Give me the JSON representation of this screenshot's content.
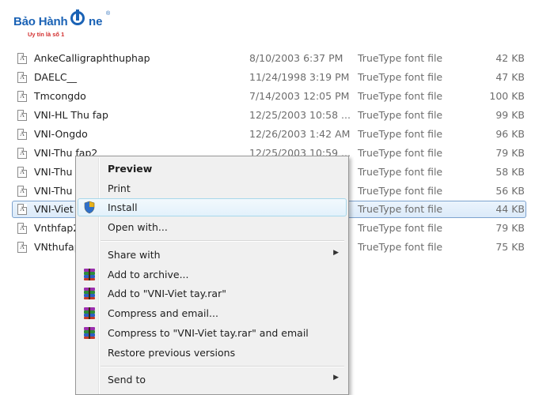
{
  "logo": {
    "brand": "Bảo Hành",
    "suffix": "ne",
    "reg": "®",
    "tagline": "Uy tín là số 1"
  },
  "files": [
    {
      "name": "AnkeCalligraphthuphap",
      "date": "8/10/2003 6:37 PM",
      "type": "TrueType font file",
      "size": "42 KB",
      "selected": false
    },
    {
      "name": "DAELC__",
      "date": "11/24/1998 3:19 PM",
      "type": "TrueType font file",
      "size": "47 KB",
      "selected": false
    },
    {
      "name": "Tmcongdo",
      "date": "7/14/2003 12:05 PM",
      "type": "TrueType font file",
      "size": "100 KB",
      "selected": false
    },
    {
      "name": "VNI-HL Thu fap",
      "date": "12/25/2003 10:58 ...",
      "type": "TrueType font file",
      "size": "99 KB",
      "selected": false
    },
    {
      "name": "VNI-Ongdo",
      "date": "12/26/2003 1:42 AM",
      "type": "TrueType font file",
      "size": "96 KB",
      "selected": false
    },
    {
      "name": "VNI-Thu fap2",
      "date": "12/25/2003 10:59 ...",
      "type": "TrueType font file",
      "size": "79 KB",
      "selected": false
    },
    {
      "name": "VNI-Thu",
      "date": "",
      "type": "TrueType font file",
      "size": "58 KB",
      "selected": false
    },
    {
      "name": "VNI-Thu",
      "date": "",
      "type": "TrueType font file",
      "size": "56 KB",
      "selected": false
    },
    {
      "name": "VNI-Viet",
      "date": "",
      "type": "TrueType font file",
      "size": "44 KB",
      "selected": true
    },
    {
      "name": "Vnthfap2",
      "date": "",
      "type": "TrueType font file",
      "size": "79 KB",
      "selected": false
    },
    {
      "name": "VNthufap",
      "date": "",
      "type": "TrueType font file",
      "size": "75 KB",
      "selected": false
    }
  ],
  "context_menu": {
    "preview": "Preview",
    "print": "Print",
    "install": "Install",
    "open_with": "Open with...",
    "share_with": "Share with",
    "add_to_archive": "Add to archive...",
    "add_to_rar": "Add to \"VNI-Viet tay.rar\"",
    "compress_email": "Compress and email...",
    "compress_rar_email": "Compress to \"VNI-Viet tay.rar\" and email",
    "restore_versions": "Restore previous versions",
    "send_to": "Send to",
    "submenu_arrow": "▶"
  },
  "colors": {
    "logo_blue": "#1a62b5",
    "logo_red": "#d22d2d",
    "selection_border": "#7da2ce",
    "menu_background": "#f0f0f0"
  }
}
